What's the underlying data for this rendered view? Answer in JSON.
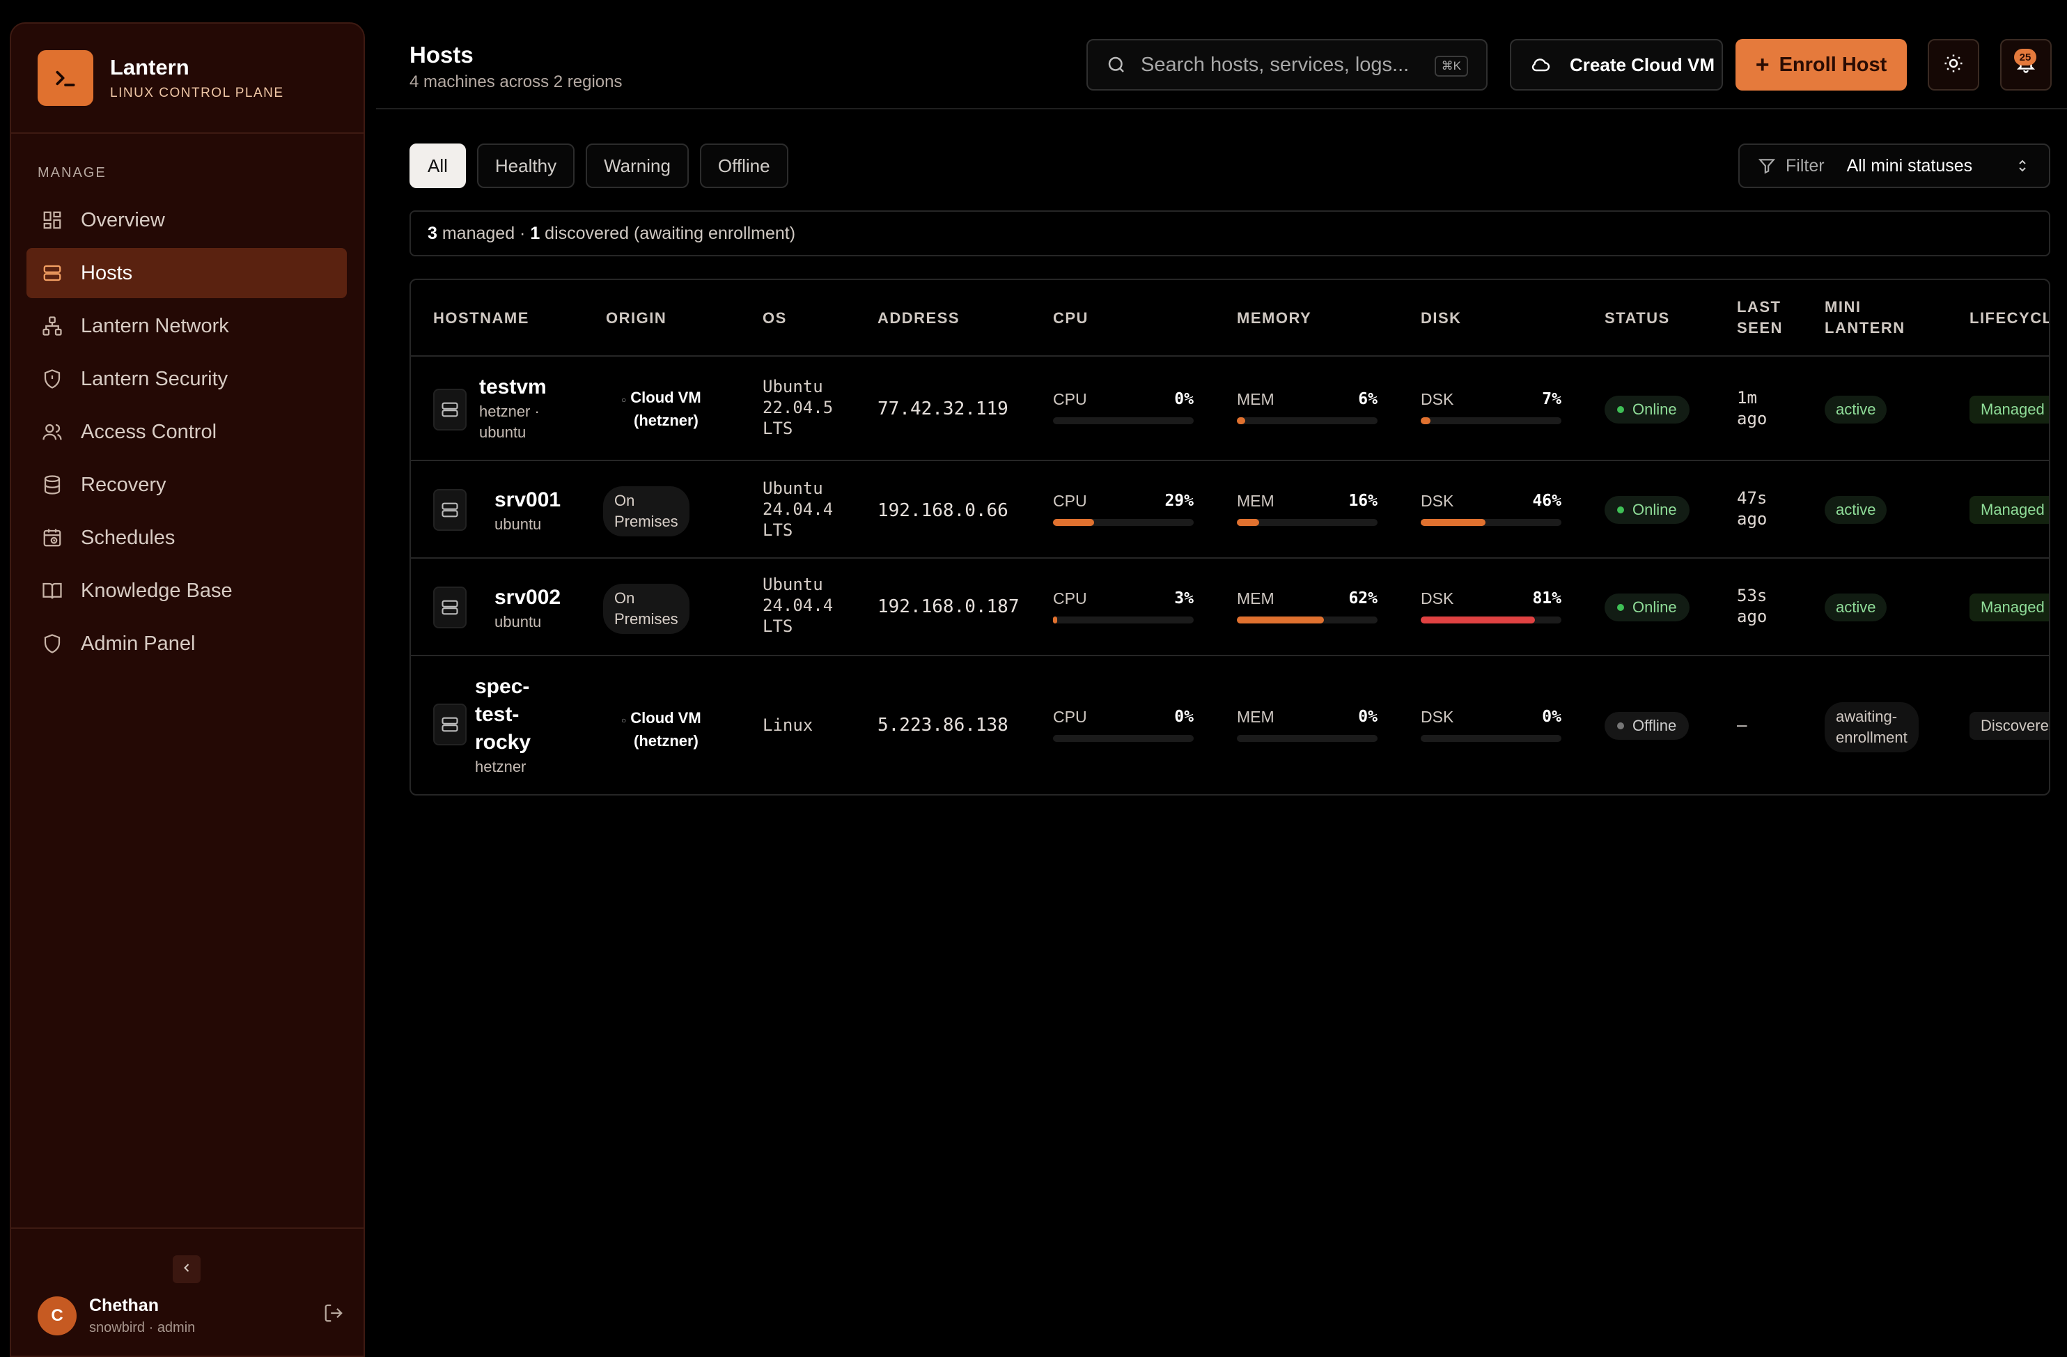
{
  "brand": {
    "name": "Lantern",
    "subtitle": "LINUX CONTROL PLANE"
  },
  "sidebar": {
    "section_label": "MANAGE",
    "items": [
      {
        "label": "Overview",
        "icon": "grid-icon"
      },
      {
        "label": "Hosts",
        "icon": "server-icon",
        "active": true
      },
      {
        "label": "Lantern Network",
        "icon": "network-icon"
      },
      {
        "label": "Lantern Security",
        "icon": "shield-check-icon"
      },
      {
        "label": "Access Control",
        "icon": "users-icon"
      },
      {
        "label": "Recovery",
        "icon": "database-icon"
      },
      {
        "label": "Schedules",
        "icon": "calendar-clock-icon"
      },
      {
        "label": "Knowledge Base",
        "icon": "book-icon"
      },
      {
        "label": "Admin Panel",
        "icon": "shield-icon"
      }
    ],
    "user": {
      "initial": "C",
      "name": "Chethan",
      "sub": "snowbird · admin"
    }
  },
  "header": {
    "title": "Hosts",
    "subtitle": "4 machines across 2 regions",
    "search_placeholder": "Search hosts, services, logs...",
    "search_shortcut": "⌘K",
    "create_vm_label": "Create Cloud VM",
    "enroll_label": "Enroll Host",
    "notification_count": "25"
  },
  "filters": {
    "tabs": [
      "All",
      "Healthy",
      "Warning",
      "Offline"
    ],
    "active_tab": "All",
    "filter_label": "Filter",
    "filter_value": "All mini statuses"
  },
  "summary": {
    "managed_count": "3",
    "managed_text": " managed · ",
    "discovered_count": "1",
    "discovered_text": " discovered (awaiting enrollment)"
  },
  "table": {
    "columns": {
      "hostname": "HOSTNAME",
      "origin": "ORIGIN",
      "os": "OS",
      "address": "ADDRESS",
      "cpu": "CPU",
      "memory": "MEMORY",
      "disk": "DISK",
      "status": "STATUS",
      "last_seen_1": "LAST",
      "last_seen_2": "SEEN",
      "mini_1": "MINI",
      "mini_2": "LANTERN",
      "lifecycle": "LIFECYCLE"
    },
    "metric_labels": {
      "cpu": "CPU",
      "mem": "MEM",
      "dsk": "DSK"
    },
    "rows": [
      {
        "name": "testvm",
        "sub1": "hetzner ·",
        "sub2": "ubuntu",
        "origin1": "Cloud VM",
        "origin2": "(hetzner)",
        "os1": "Ubuntu",
        "os2": "22.04.5",
        "os3": "LTS",
        "address": "77.42.32.119",
        "cpu": "0%",
        "mem": "6%",
        "dsk": "7%",
        "cpu_val": 0,
        "mem_val": 6,
        "dsk_val": 7,
        "status": "Online",
        "seen1": "1m",
        "seen2": "ago",
        "mini": "active",
        "lifecycle": "Managed"
      },
      {
        "name": "srv001",
        "sub1": "ubuntu",
        "origin1": "On",
        "origin2": "Premises",
        "os1": "Ubuntu",
        "os2": "24.04.4",
        "os3": "LTS",
        "address": "192.168.0.66",
        "cpu": "29%",
        "mem": "16%",
        "dsk": "46%",
        "cpu_val": 29,
        "mem_val": 16,
        "dsk_val": 46,
        "status": "Online",
        "seen1": "47s",
        "seen2": "ago",
        "mini": "active",
        "lifecycle": "Managed"
      },
      {
        "name": "srv002",
        "sub1": "ubuntu",
        "origin1": "On",
        "origin2": "Premises",
        "os1": "Ubuntu",
        "os2": "24.04.4",
        "os3": "LTS",
        "address": "192.168.0.187",
        "cpu": "3%",
        "mem": "62%",
        "dsk": "81%",
        "cpu_val": 3,
        "mem_val": 62,
        "dsk_val": 81,
        "status": "Online",
        "seen1": "53s",
        "seen2": "ago",
        "mini": "active",
        "lifecycle": "Managed"
      },
      {
        "name1": "spec-",
        "name2": "test-",
        "name3": "rocky",
        "sub1": "hetzner",
        "origin1": "Cloud VM",
        "origin2": "(hetzner)",
        "os1": "Linux",
        "address": "5.223.86.138",
        "cpu": "0%",
        "mem": "0%",
        "dsk": "0%",
        "cpu_val": 0,
        "mem_val": 0,
        "dsk_val": 0,
        "status": "Offline",
        "seen1": "—",
        "mini1": "awaiting-",
        "mini2": "enrollment",
        "lifecycle": "Discovered"
      }
    ]
  },
  "colors": {
    "accent": "#e57a3c",
    "danger": "#e04242",
    "ok": "#3fc056"
  }
}
